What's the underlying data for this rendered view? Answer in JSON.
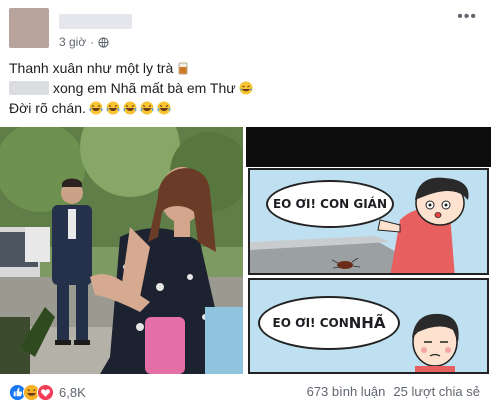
{
  "post": {
    "time": "3 giờ",
    "separator": "·",
    "lines": [
      "Thanh xuân như một ly trà",
      "xong em Nhã mất bà em Thư",
      "Đời rõ chán."
    ]
  },
  "comic": {
    "panel1_text": "EO ƠI! CON GIÁN",
    "panel2_text_a": "EO ƠI! CON",
    "panel2_text_b": "NHÃ"
  },
  "footer": {
    "reaction_count": "6,8K",
    "comments": "673 bình luận",
    "shares": "25 lượt chia sẻ"
  },
  "icons": {
    "time_privacy": "globe-icon",
    "menu": "more-icon",
    "reactions": [
      "like-icon",
      "haha-icon",
      "love-icon"
    ]
  },
  "colors": {
    "like": "#1877f2",
    "haha": "#f7b125",
    "love": "#f33e58"
  }
}
